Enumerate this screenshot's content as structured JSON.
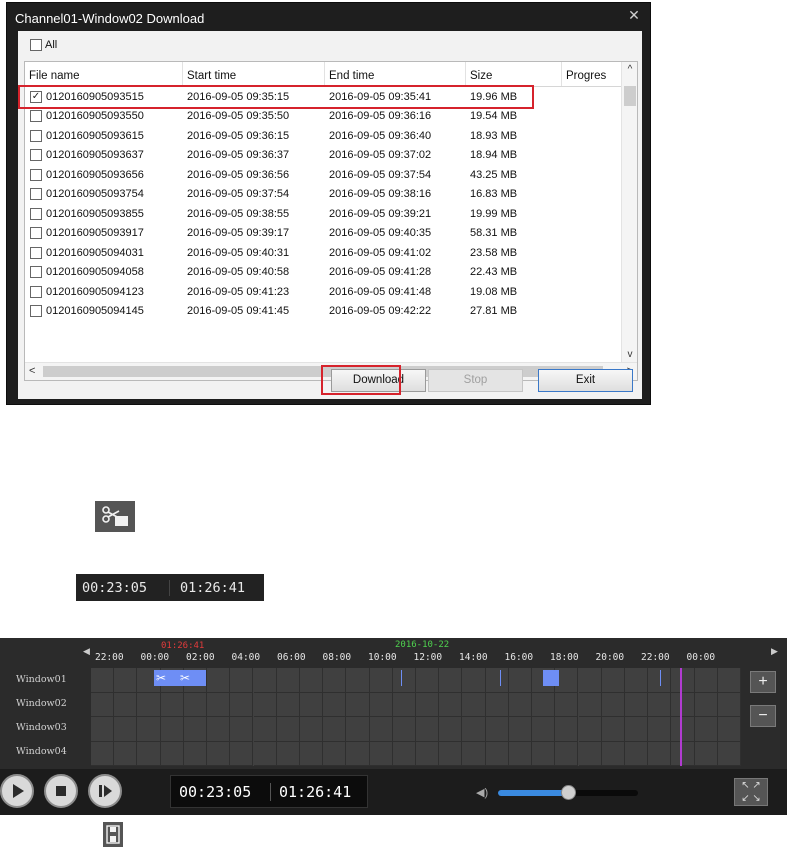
{
  "dialog": {
    "title": "Channel01-Window02 Download",
    "close": "✕",
    "all_label": "All",
    "columns": [
      "File name",
      "Start time",
      "End time",
      "Size",
      "Progres"
    ],
    "rows": [
      {
        "checked": true,
        "file": "0120160905093515",
        "start": "2016-09-05 09:35:15",
        "end": "2016-09-05 09:35:41",
        "size": "19.96 MB"
      },
      {
        "checked": false,
        "file": "0120160905093550",
        "start": "2016-09-05 09:35:50",
        "end": "2016-09-05 09:36:16",
        "size": "19.54 MB"
      },
      {
        "checked": false,
        "file": "0120160905093615",
        "start": "2016-09-05 09:36:15",
        "end": "2016-09-05 09:36:40",
        "size": "18.93 MB"
      },
      {
        "checked": false,
        "file": "0120160905093637",
        "start": "2016-09-05 09:36:37",
        "end": "2016-09-05 09:37:02",
        "size": "18.94 MB"
      },
      {
        "checked": false,
        "file": "0120160905093656",
        "start": "2016-09-05 09:36:56",
        "end": "2016-09-05 09:37:54",
        "size": "43.25 MB"
      },
      {
        "checked": false,
        "file": "0120160905093754",
        "start": "2016-09-05 09:37:54",
        "end": "2016-09-05 09:38:16",
        "size": "16.83 MB"
      },
      {
        "checked": false,
        "file": "0120160905093855",
        "start": "2016-09-05 09:38:55",
        "end": "2016-09-05 09:39:21",
        "size": "19.99 MB"
      },
      {
        "checked": false,
        "file": "0120160905093917",
        "start": "2016-09-05 09:39:17",
        "end": "2016-09-05 09:40:35",
        "size": "58.31 MB"
      },
      {
        "checked": false,
        "file": "0120160905094031",
        "start": "2016-09-05 09:40:31",
        "end": "2016-09-05 09:41:02",
        "size": "23.58 MB"
      },
      {
        "checked": false,
        "file": "0120160905094058",
        "start": "2016-09-05 09:40:58",
        "end": "2016-09-05 09:41:28",
        "size": "22.43 MB"
      },
      {
        "checked": false,
        "file": "0120160905094123",
        "start": "2016-09-05 09:41:23",
        "end": "2016-09-05 09:41:48",
        "size": "19.08 MB"
      },
      {
        "checked": false,
        "file": "0120160905094145",
        "start": "2016-09-05 09:41:45",
        "end": "2016-09-05 09:42:22",
        "size": "27.81 MB"
      }
    ],
    "buttons": {
      "download": "Download",
      "stop": "Stop",
      "exit": "Exit"
    },
    "scroll": {
      "up": "^",
      "down": "v",
      "left": "<",
      "right": ">"
    }
  },
  "cut_icon": "scissors-clip-icon",
  "time_sample": {
    "start": "00:23:05",
    "end": "01:26:41"
  },
  "timeline": {
    "ticks": [
      "22:00",
      "00:00",
      "02:00",
      "04:00",
      "06:00",
      "08:00",
      "10:00",
      "12:00",
      "14:00",
      "16:00",
      "18:00",
      "20:00",
      "22:00",
      "00:00"
    ],
    "marker_time": "01:26:41",
    "marker_date": "2016-10-22",
    "channels": [
      "Window01",
      "Window02",
      "Window03",
      "Window04"
    ],
    "zoom_in": "+",
    "zoom_out": "−",
    "nav_left": "◀",
    "nav_right": "▶"
  },
  "controls": {
    "current_time": "00:23:05",
    "end_time": "01:26:41",
    "volume_level": 0.5,
    "volume_icon": "speaker-icon",
    "fullscreen_icon": "fullscreen-icon"
  },
  "save_icon": "save-icon",
  "colors": {
    "highlight": "#d6232c",
    "record": "#6e8ef5",
    "playhead": "#b13bd1",
    "marker_red": "#e23b3b",
    "marker_green": "#4fd24f",
    "volume": "#3a8ae0"
  }
}
